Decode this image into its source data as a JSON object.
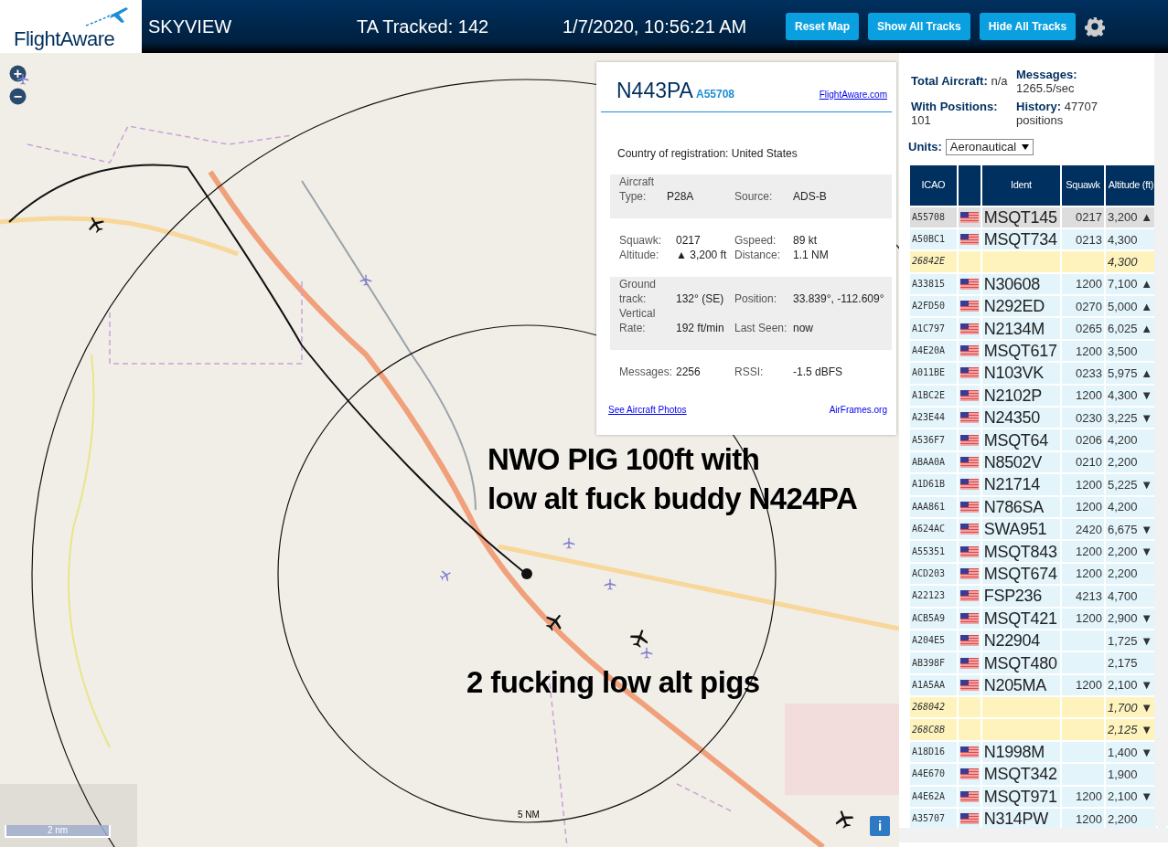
{
  "header": {
    "logo": "FlightAware",
    "title": "SKYVIEW",
    "tracked": "TA Tracked: 142",
    "datetime": "1/7/2020, 10:56:21 AM",
    "buttons": [
      "Reset Map",
      "Show All Tracks",
      "Hide All Tracks"
    ]
  },
  "map": {
    "zoom_in": "+",
    "zoom_out": "−",
    "range_label": "5 NM",
    "scale": "2 nm",
    "info_button": "i",
    "annotations": [
      "NWO PIG 100ft with\nlow alt fuck buddy N424PA",
      "2 fucking low alt pigs"
    ]
  },
  "info_panel": {
    "callsign": "N443PA",
    "icao": "A55708",
    "site_link": "FlightAware.com",
    "country_label": "Country of registration:",
    "country": "United States",
    "sections": [
      {
        "shaded": true,
        "fields": [
          [
            "Aircraft Type:",
            "P28A"
          ],
          [
            "Source:",
            "ADS-B"
          ]
        ]
      },
      {
        "shaded": false,
        "fields": [
          [
            "Squawk:",
            "0217"
          ],
          [
            "Gspeed:",
            "89 kt"
          ],
          [
            "Altitude:",
            "▲ 3,200 ft"
          ],
          [
            "Distance:",
            "1.1 NM"
          ]
        ]
      },
      {
        "shaded": true,
        "fields": [
          [
            "Ground track:",
            "132° (SE)"
          ],
          [
            "Position:",
            "33.839°, -112.609°"
          ],
          [
            "Vertical Rate:",
            "192 ft/min"
          ],
          [
            "Last Seen:",
            "now"
          ]
        ]
      },
      {
        "shaded": false,
        "fields": [
          [
            "Messages:",
            "2256"
          ],
          [
            "RSSI:",
            "-1.5 dBFS"
          ]
        ]
      }
    ],
    "photos_link": "See Aircraft Photos",
    "airframes_link": "AirFrames.org"
  },
  "stats": [
    "**Total Aircraft:** n/a",
    "**Messages:** 1265.5/sec",
    "**With Positions:** 101",
    "**History:** 47707 positions"
  ],
  "units": {
    "label": "Units:",
    "value": "Aeronautical"
  },
  "table": {
    "columns": [
      "ICAO",
      "",
      "Ident",
      "Squawk",
      "Altitude (ft)"
    ],
    "rows": [
      {
        "icao": "A55708",
        "flag": true,
        "ident": "MSQT145",
        "squawk": "0217",
        "altitude": "3,200 ▲",
        "kind": "standard",
        "selected": true
      },
      {
        "icao": "A50BC1",
        "flag": true,
        "ident": "MSQT734",
        "squawk": "0213",
        "altitude": "4,300",
        "kind": "standard",
        "selected": false
      },
      {
        "icao": "26842E",
        "flag": false,
        "ident": "",
        "squawk": "",
        "altitude": "4,300",
        "kind": "unidentified",
        "selected": false
      },
      {
        "icao": "A33815",
        "flag": true,
        "ident": "N30608",
        "squawk": "1200",
        "altitude": "7,100 ▲",
        "kind": "standard",
        "selected": false
      },
      {
        "icao": "A2FD50",
        "flag": true,
        "ident": "N292ED",
        "squawk": "0270",
        "altitude": "5,000 ▲",
        "kind": "standard",
        "selected": false
      },
      {
        "icao": "A1C797",
        "flag": true,
        "ident": "N2134M",
        "squawk": "0265",
        "altitude": "6,025 ▲",
        "kind": "standard",
        "selected": false
      },
      {
        "icao": "A4E20A",
        "flag": true,
        "ident": "MSQT617",
        "squawk": "1200",
        "altitude": "3,500",
        "kind": "standard",
        "selected": false
      },
      {
        "icao": "A011BE",
        "flag": true,
        "ident": "N103VK",
        "squawk": "0233",
        "altitude": "5,975 ▲",
        "kind": "standard",
        "selected": false
      },
      {
        "icao": "A1BC2E",
        "flag": true,
        "ident": "N2102P",
        "squawk": "1200",
        "altitude": "4,300 ▼",
        "kind": "standard",
        "selected": false
      },
      {
        "icao": "A23E44",
        "flag": true,
        "ident": "N24350",
        "squawk": "0230",
        "altitude": "3,225 ▼",
        "kind": "standard",
        "selected": false
      },
      {
        "icao": "A536F7",
        "flag": true,
        "ident": "MSQT64",
        "squawk": "0206",
        "altitude": "4,200",
        "kind": "standard",
        "selected": false
      },
      {
        "icao": "ABAA0A",
        "flag": true,
        "ident": "N8502V",
        "squawk": "0210",
        "altitude": "2,200",
        "kind": "standard",
        "selected": false
      },
      {
        "icao": "A1D61B",
        "flag": true,
        "ident": "N21714",
        "squawk": "1200",
        "altitude": "5,225 ▼",
        "kind": "standard",
        "selected": false
      },
      {
        "icao": "AAA861",
        "flag": true,
        "ident": "N786SA",
        "squawk": "1200",
        "altitude": "4,200",
        "kind": "standard",
        "selected": false
      },
      {
        "icao": "A624AC",
        "flag": true,
        "ident": "SWA951",
        "squawk": "2420",
        "altitude": "6,675 ▼",
        "kind": "standard",
        "selected": false
      },
      {
        "icao": "A55351",
        "flag": true,
        "ident": "MSQT843",
        "squawk": "1200",
        "altitude": "2,200 ▼",
        "kind": "standard",
        "selected": false
      },
      {
        "icao": "ACD203",
        "flag": true,
        "ident": "MSQT674",
        "squawk": "1200",
        "altitude": "2,200",
        "kind": "standard",
        "selected": false
      },
      {
        "icao": "A22123",
        "flag": true,
        "ident": "FSP236",
        "squawk": "4213",
        "altitude": "4,700",
        "kind": "standard",
        "selected": false
      },
      {
        "icao": "ACB5A9",
        "flag": true,
        "ident": "MSQT421",
        "squawk": "1200",
        "altitude": "2,900 ▼",
        "kind": "standard",
        "selected": false
      },
      {
        "icao": "A204E5",
        "flag": true,
        "ident": "N22904",
        "squawk": "",
        "altitude": "1,725 ▼",
        "kind": "standard",
        "selected": false
      },
      {
        "icao": "AB398F",
        "flag": true,
        "ident": "MSQT480",
        "squawk": "",
        "altitude": "2,175",
        "kind": "standard",
        "selected": false
      },
      {
        "icao": "A1A5AA",
        "flag": true,
        "ident": "N205MA",
        "squawk": "1200",
        "altitude": "2,100 ▼",
        "kind": "standard",
        "selected": false
      },
      {
        "icao": "268042",
        "flag": false,
        "ident": "",
        "squawk": "",
        "altitude": "1,700 ▼",
        "kind": "unidentified",
        "selected": false
      },
      {
        "icao": "268C8B",
        "flag": false,
        "ident": "",
        "squawk": "",
        "altitude": "2,125 ▼",
        "kind": "unidentified",
        "selected": false
      },
      {
        "icao": "A18D16",
        "flag": true,
        "ident": "N1998M",
        "squawk": "",
        "altitude": "1,400 ▼",
        "kind": "standard",
        "selected": false
      },
      {
        "icao": "A4E670",
        "flag": true,
        "ident": "MSQT342",
        "squawk": "",
        "altitude": "1,900",
        "kind": "standard",
        "selected": false
      },
      {
        "icao": "A4E62A",
        "flag": true,
        "ident": "MSQT971",
        "squawk": "1200",
        "altitude": "2,100 ▼",
        "kind": "standard",
        "selected": false
      },
      {
        "icao": "A35707",
        "flag": true,
        "ident": "N314PW",
        "squawk": "1200",
        "altitude": "2,200",
        "kind": "standard",
        "selected": false
      }
    ]
  }
}
